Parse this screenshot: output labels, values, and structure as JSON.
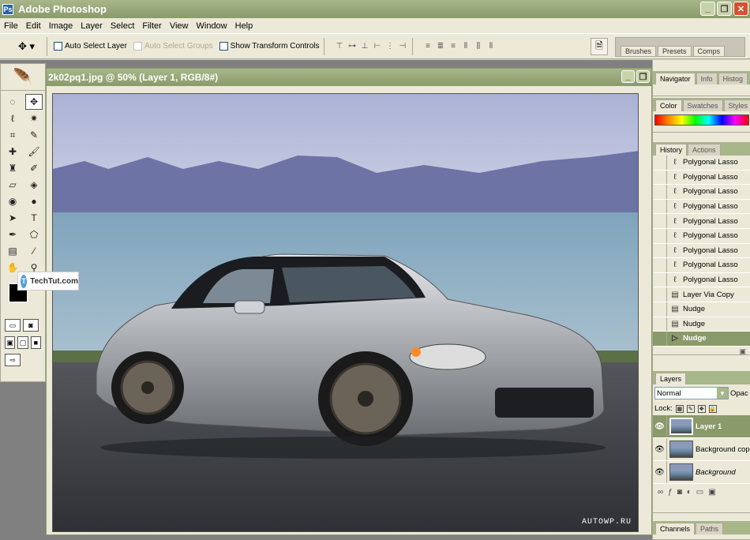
{
  "app": {
    "title": "Adobe Photoshop",
    "icon": "Ps"
  },
  "window_buttons": [
    "_",
    "❐",
    "✕"
  ],
  "menu": [
    "File",
    "Edit",
    "Image",
    "Layer",
    "Select",
    "Filter",
    "View",
    "Window",
    "Help"
  ],
  "options": {
    "auto_select_layer": "Auto Select Layer",
    "auto_select_groups": "Auto Select Groups",
    "show_transform_controls": "Show Transform Controls"
  },
  "palette_well": [
    "Brushes",
    "Presets",
    "Comps"
  ],
  "document": {
    "title": "2k02pq1.jpg @ 50% (Layer 1, RGB/8#)",
    "watermark": "AUTOWP.RU"
  },
  "overlay": {
    "text": "TechTut.com"
  },
  "navigator_tabs": [
    "Navigator",
    "Info",
    "Histog"
  ],
  "color_tabs": [
    "Color",
    "Swatches",
    "Styles"
  ],
  "history_tabs": [
    "History",
    "Actions"
  ],
  "history": [
    "Polygonal Lasso",
    "Polygonal Lasso",
    "Polygonal Lasso",
    "Polygonal Lasso",
    "Polygonal Lasso",
    "Polygonal Lasso",
    "Polygonal Lasso",
    "Polygonal Lasso",
    "Polygonal Lasso",
    "Layer Via Copy",
    "Nudge",
    "Nudge",
    "Nudge"
  ],
  "layers": {
    "tab": "Layers",
    "blend_mode": "Normal",
    "opacity_label": "Opac",
    "lock_label": "Lock:",
    "items": [
      "Layer 1",
      "Background cop",
      "Background"
    ]
  },
  "channels_tabs": [
    "Channels",
    "Paths"
  ]
}
